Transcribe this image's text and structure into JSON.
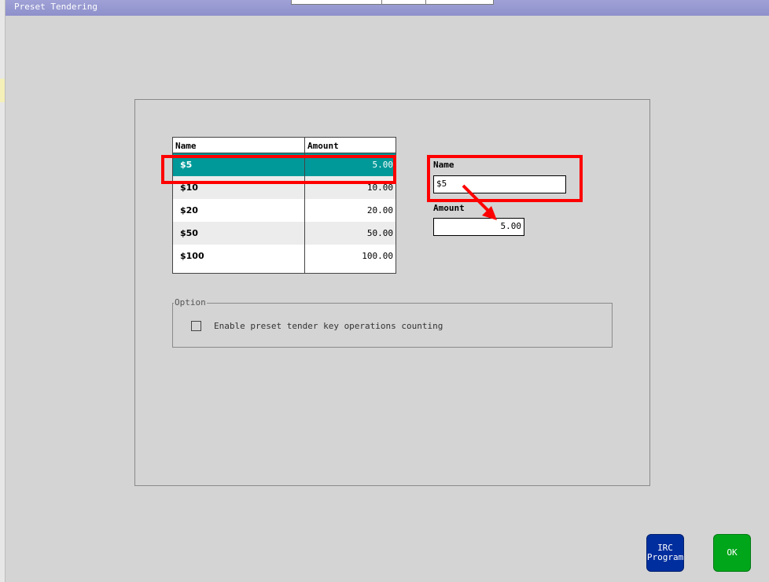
{
  "window": {
    "title": "Preset Tendering"
  },
  "table": {
    "columns": [
      "Name",
      "Amount"
    ],
    "rows": [
      {
        "name": "$5",
        "amount": "5.00",
        "selected": true
      },
      {
        "name": "$10",
        "amount": "10.00"
      },
      {
        "name": "$20",
        "amount": "20.00"
      },
      {
        "name": "$50",
        "amount": "50.00"
      },
      {
        "name": "$100",
        "amount": "100.00"
      }
    ]
  },
  "detail": {
    "name_label": "Name",
    "name_value": "$5",
    "amount_label": "Amount",
    "amount_value": "5.00"
  },
  "option": {
    "legend": "Option",
    "checkbox_label": "Enable preset tender key operations counting",
    "checked": false
  },
  "buttons": {
    "irc_line1": "IRC",
    "irc_line2": "Program",
    "ok_label": "OK"
  },
  "colors": {
    "selected_row": "#009999",
    "annotation": "#ff0000",
    "irc_button": "#002e9e",
    "ok_button": "#00a61a"
  }
}
